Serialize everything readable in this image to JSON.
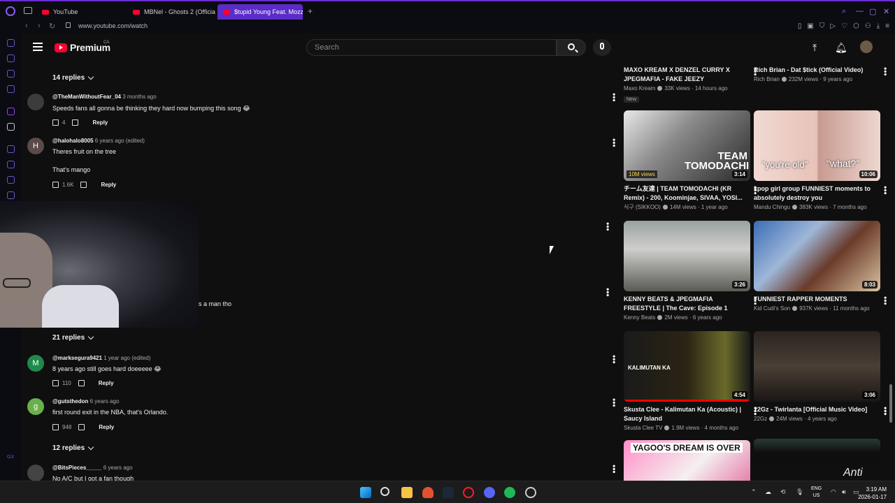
{
  "browser": {
    "tabs": [
      {
        "label": "YouTube"
      },
      {
        "label": "MBNel - Ghosts 2 (Officia"
      },
      {
        "label": "$tupid Young Feat. Mozzy"
      }
    ],
    "url": "www.youtube.com/watch"
  },
  "header": {
    "logo_text": "Premium",
    "region": "CA",
    "search_placeholder": "Search"
  },
  "comments": {
    "replies_1": "14 replies",
    "items": [
      {
        "author": "@TheManWithoutFear_04",
        "time": "3 months ago",
        "text": "Speeds fans all gonna be thinking they hard now bumping this song 😂",
        "likes": "4",
        "reply": "Reply"
      },
      {
        "author": "@halohalo8005",
        "time": "6 years ago (edited)",
        "text": "Theres fruit on the tree",
        "text2": "That's mango",
        "likes": "1.6K",
        "reply": "Reply",
        "initial": "H"
      },
      {
        "author": "@marksegura9421",
        "time": "1 year ago (edited)",
        "text": "8 years ago still goes hard doeeeee 😂",
        "likes": "110",
        "reply": "Reply",
        "initial": "M"
      },
      {
        "author": "@gutsthedon",
        "time": "6 years ago",
        "text": "first round exit in the NBA, that's Orlando.",
        "likes": "948",
        "reply": "Reply",
        "initial": "g"
      },
      {
        "author": "@BitsPieces_____",
        "time": "6 years ago",
        "text": "No A/C but I got a fan though"
      }
    ],
    "hidden_text_tail": "s a man tho",
    "replies_2": "21 replies",
    "replies_3": "12 replies"
  },
  "recommendations": [
    {
      "title": "MAXO KREAM X DENZEL CURRY X JPEGMAFIA - FAKE JEEZY",
      "channel": "Maxo Kream",
      "meta": "33K views · 14 hours ago",
      "badge": "New"
    },
    {
      "title": "Rich Brian - Dat $tick (Official Video)",
      "channel": "Rich Brian",
      "meta": "232M views · 9 years ago"
    },
    {
      "title": "チーム友達 | TEAM TOMODACHI (KR Remix) - 200, Koominjae, SIVAA, YOSI...",
      "channel": "식구 (SIKKOO)",
      "meta": "14M views · 1 year ago",
      "duration": "3:14",
      "views_badge": "10M views",
      "thumb_text": "TEAM TOMODACHI"
    },
    {
      "title": "kpop girl group FUNNIEST moments to absolutely destroy you",
      "channel": "Mandu Chingu",
      "meta": "383K views · 7 months ago",
      "duration": "10:06",
      "thumb_text_left": "\"you're old\"",
      "thumb_text_right": "\"what?\""
    },
    {
      "title": "KENNY BEATS & JPEGMAFIA FREESTYLE | The Cave: Episode 1",
      "channel": "Kenny Beats",
      "meta": "2M views · 6 years ago",
      "duration": "3:26"
    },
    {
      "title": "FUNNIEST RAPPER MOMENTS",
      "channel": "Kid Cudi's Son",
      "meta": "937K views · 11 months ago",
      "duration": "8:03"
    },
    {
      "title": "Skusta Clee - Kalimutan Ka (Acoustic) | Saucy Island",
      "channel": "Skusta Clee TV",
      "meta": "1.9M views · 4 months ago",
      "duration": "4:54",
      "thumb_text": "KALIMUTAN KA"
    },
    {
      "title": "22Gz - Twirlanta [Official Music Video]",
      "channel": "22Gz",
      "meta": "24M views · 4 years ago",
      "duration": "3:06"
    },
    {
      "thumb_text": "YAGOO'S DREAM IS OVER"
    },
    {
      "thumb_text": "Anti"
    }
  ],
  "taskbar": {
    "lang": "ENG",
    "region": "US",
    "time": "3:19 AM",
    "date": "2026-01-17"
  }
}
